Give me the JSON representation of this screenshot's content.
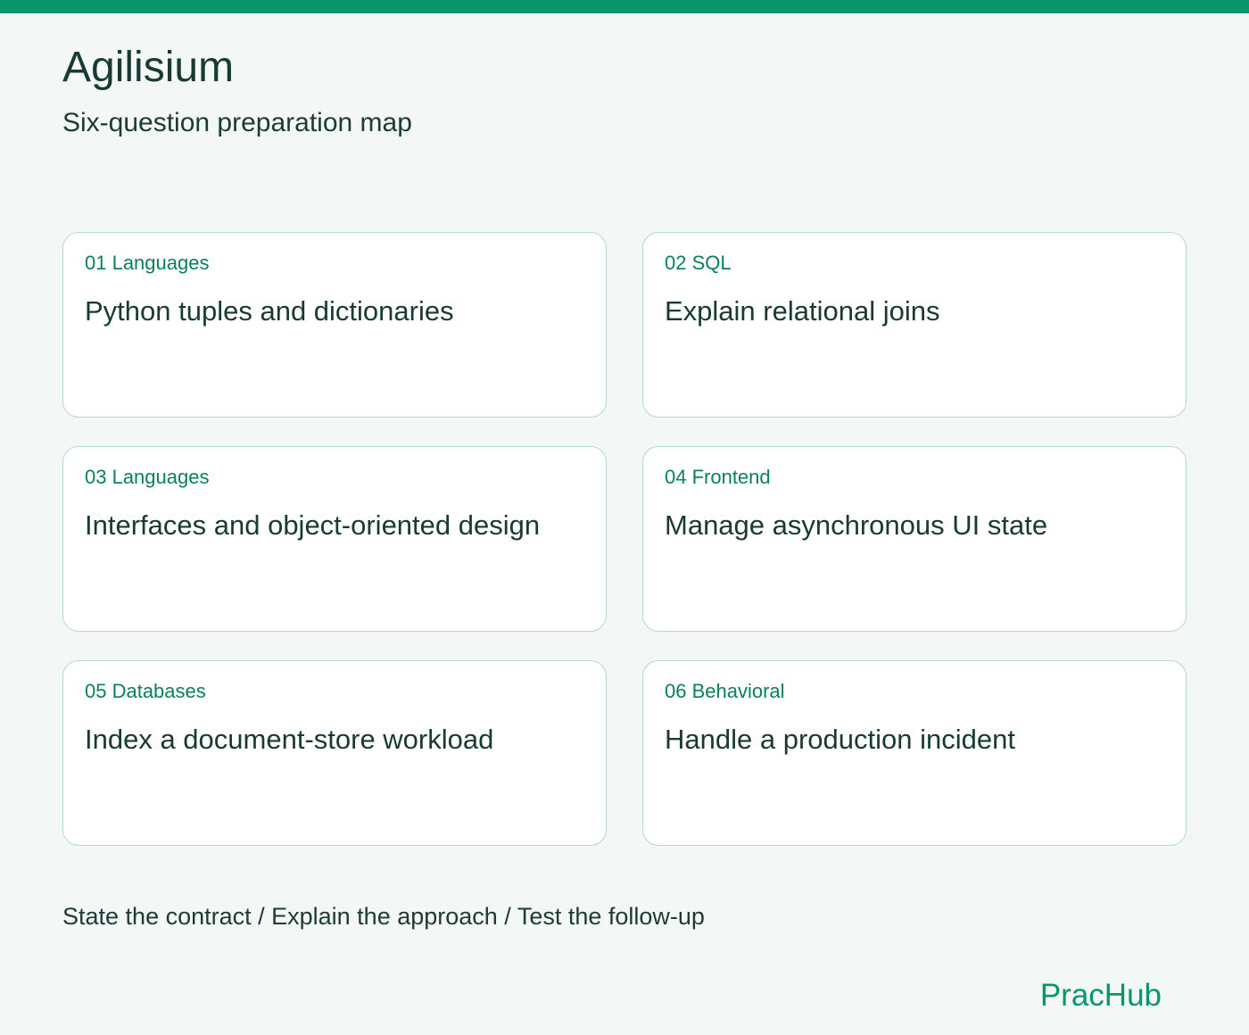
{
  "header": {
    "title": "Agilisium",
    "subtitle": "Six-question preparation map"
  },
  "cards": [
    {
      "tag": "01 Languages",
      "title": "Python tuples and dictionaries"
    },
    {
      "tag": "02 SQL",
      "title": "Explain relational joins"
    },
    {
      "tag": "03 Languages",
      "title": "Interfaces and object-oriented design"
    },
    {
      "tag": "04 Frontend",
      "title": "Manage asynchronous UI state"
    },
    {
      "tag": "05 Databases",
      "title": "Index a document-store workload"
    },
    {
      "tag": "06 Behavioral",
      "title": "Handle a production incident"
    }
  ],
  "footer": {
    "steps": "State the contract / Explain the approach / Test the follow-up",
    "brand": "PracHub"
  },
  "colors": {
    "accent": "#06966c",
    "card_border": "#b7d8cd",
    "background": "#f3f8f6"
  }
}
